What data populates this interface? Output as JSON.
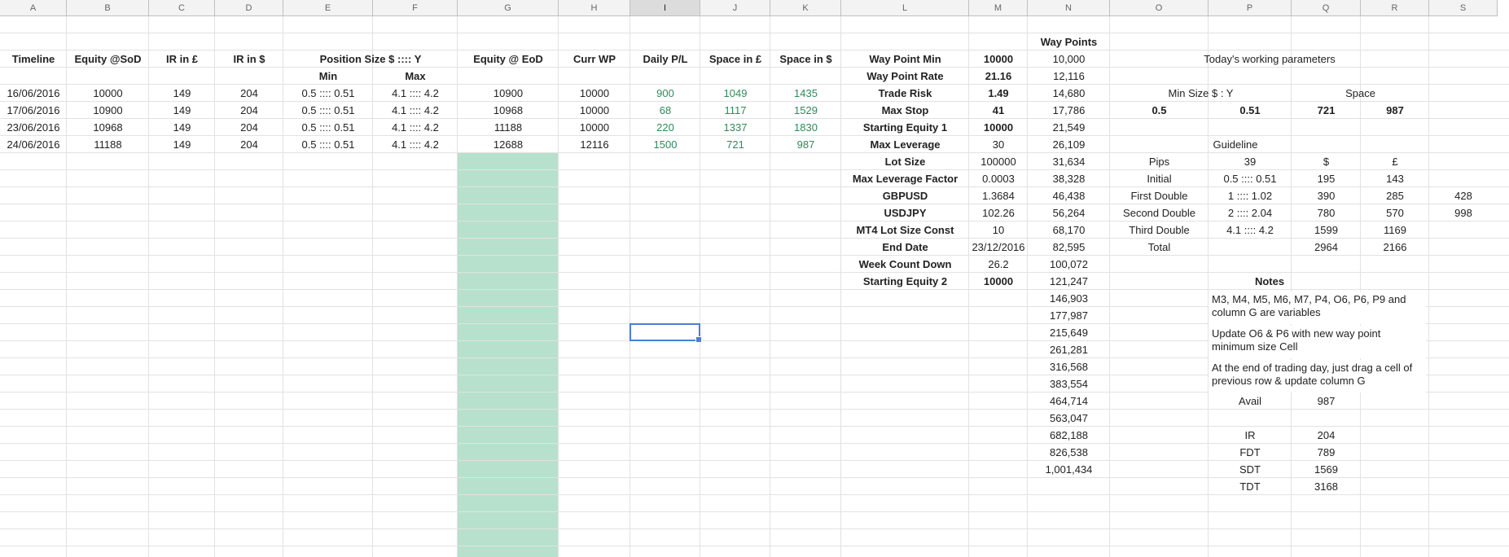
{
  "columns": [
    "A",
    "B",
    "C",
    "D",
    "E",
    "F",
    "G",
    "H",
    "I",
    "J",
    "K",
    "L",
    "M",
    "N",
    "O",
    "P",
    "Q",
    "R",
    "S"
  ],
  "selected_column": "I",
  "header_row": [
    {
      "col": "A",
      "text": "Timeline"
    },
    {
      "col": "B",
      "text": "Equity @SoD"
    },
    {
      "col": "C",
      "text": "IR in £"
    },
    {
      "col": "D",
      "text": "IR in $"
    },
    {
      "col": "EF",
      "text": "Position Size $ :::: Y"
    },
    {
      "col": "G",
      "text": "Equity @ EoD"
    },
    {
      "col": "H",
      "text": "Curr WP"
    },
    {
      "col": "I",
      "text": "Daily P/L"
    },
    {
      "col": "J",
      "text": "Space in £"
    },
    {
      "col": "K",
      "text": "Space in $"
    }
  ],
  "subheaders": {
    "min": "Min",
    "max": "Max"
  },
  "rows": [
    {
      "date": "16/06/2016",
      "equity_sod": "10000",
      "ir_gbp": "149",
      "ir_usd": "204",
      "pos_min": "0.5 :::: 0.51",
      "pos_max": "4.1 :::: 4.2",
      "equity_eod": "10900",
      "curr_wp": "10000",
      "daily_pl": "900",
      "space_gbp": "1049",
      "space_usd": "1435"
    },
    {
      "date": "17/06/2016",
      "equity_sod": "10900",
      "ir_gbp": "149",
      "ir_usd": "204",
      "pos_min": "0.5 :::: 0.51",
      "pos_max": "4.1 :::: 4.2",
      "equity_eod": "10968",
      "curr_wp": "10000",
      "daily_pl": "68",
      "space_gbp": "1117",
      "space_usd": "1529"
    },
    {
      "date": "23/06/2016",
      "equity_sod": "10968",
      "ir_gbp": "149",
      "ir_usd": "204",
      "pos_min": "0.5 :::: 0.51",
      "pos_max": "4.1 :::: 4.2",
      "equity_eod": "11188",
      "curr_wp": "10000",
      "daily_pl": "220",
      "space_gbp": "1337",
      "space_usd": "1830"
    },
    {
      "date": "24/06/2016",
      "equity_sod": "11188",
      "ir_gbp": "149",
      "ir_usd": "204",
      "pos_min": "0.5 :::: 0.51",
      "pos_max": "4.1 :::: 4.2",
      "equity_eod": "12688",
      "curr_wp": "12116",
      "daily_pl": "1500",
      "space_gbp": "721",
      "space_usd": "987"
    }
  ],
  "params": [
    {
      "label": "Way Point Min",
      "value": "10000",
      "bold": true
    },
    {
      "label": "Way Point Rate",
      "value": "21.16",
      "bold": true
    },
    {
      "label": "Trade Risk",
      "value": "1.49",
      "bold": true
    },
    {
      "label": "Max Stop",
      "value": "41",
      "bold": true
    },
    {
      "label": "Starting Equity 1",
      "value": "10000",
      "bold": true
    },
    {
      "label": "Max Leverage",
      "value": "30",
      "bold": false
    },
    {
      "label": "Lot Size",
      "value": "100000",
      "bold": false
    },
    {
      "label": "Max Leverage Factor",
      "value": "0.0003",
      "bold": false
    },
    {
      "label": "GBPUSD",
      "value": "1.3684",
      "bold": false
    },
    {
      "label": "USDJPY",
      "value": "102.26",
      "bold": false
    },
    {
      "label": "MT4 Lot Size Const",
      "value": "10",
      "bold": false
    },
    {
      "label": "End Date",
      "value": "23/12/2016",
      "bold": false
    },
    {
      "label": "Week Count Down",
      "value": "26.2",
      "bold": false
    },
    {
      "label": "Starting Equity 2",
      "value": "10000",
      "bold": true
    }
  ],
  "waypoints_header": "Way Points",
  "waypoints": [
    "10,000",
    "12,116",
    "14,680",
    "17,786",
    "21,549",
    "26,109",
    "31,634",
    "38,328",
    "46,438",
    "56,264",
    "68,170",
    "82,595",
    "100,072",
    "121,247",
    "146,903",
    "177,987",
    "215,649",
    "261,281",
    "316,568",
    "383,554",
    "464,714",
    "563,047",
    "682,188",
    "826,538",
    "1,001,434"
  ],
  "working": {
    "title": "Today's working parameters",
    "min_size_label": "Min Size $ : Y",
    "space_label": "Space",
    "min_a": "0.5",
    "min_b": "0.51",
    "space_usd": "721",
    "space_gbp": "987"
  },
  "guideline": {
    "title": "Guideline",
    "headers": {
      "pips": "Pips",
      "pips_value": "39",
      "usd": "$",
      "gbp": "£"
    },
    "rows": [
      {
        "label": "Initial",
        "size": "0.5 :::: 0.51",
        "usd": "195",
        "gbp": "143",
        "extra": ""
      },
      {
        "label": "First Double",
        "size": "1   :::: 1.02",
        "usd": "390",
        "gbp": "285",
        "extra": "428"
      },
      {
        "label": "Second Double",
        "size": "2   :::: 2.04",
        "usd": "780",
        "gbp": "570",
        "extra": "998"
      },
      {
        "label": "Third Double",
        "size": "4.1   ::::  4.2",
        "usd": "1599",
        "gbp": "1169",
        "extra": ""
      },
      {
        "label": "Total",
        "size": "",
        "usd": "2964",
        "gbp": "2166",
        "extra": ""
      }
    ]
  },
  "notes": {
    "title": "Notes",
    "items": [
      "M3, M4, M5, M6, M7, P4, O6, P6, P9 and column G are variables",
      "Update O6 & P6 with new way point minimum size Cell",
      "At the end of trading day, just drag a cell of previous row & update column G"
    ]
  },
  "summary": [
    {
      "label": "Avail",
      "value": "987"
    },
    {
      "label": "",
      "value": ""
    },
    {
      "label": "IR",
      "value": "204"
    },
    {
      "label": "FDT",
      "value": "789"
    },
    {
      "label": "SDT",
      "value": "1569"
    },
    {
      "label": "TDT",
      "value": "3168"
    }
  ],
  "colors": {
    "fill": "#b7e1cd",
    "positive": "#2e8a5a",
    "selection": "#4a7ddc"
  }
}
